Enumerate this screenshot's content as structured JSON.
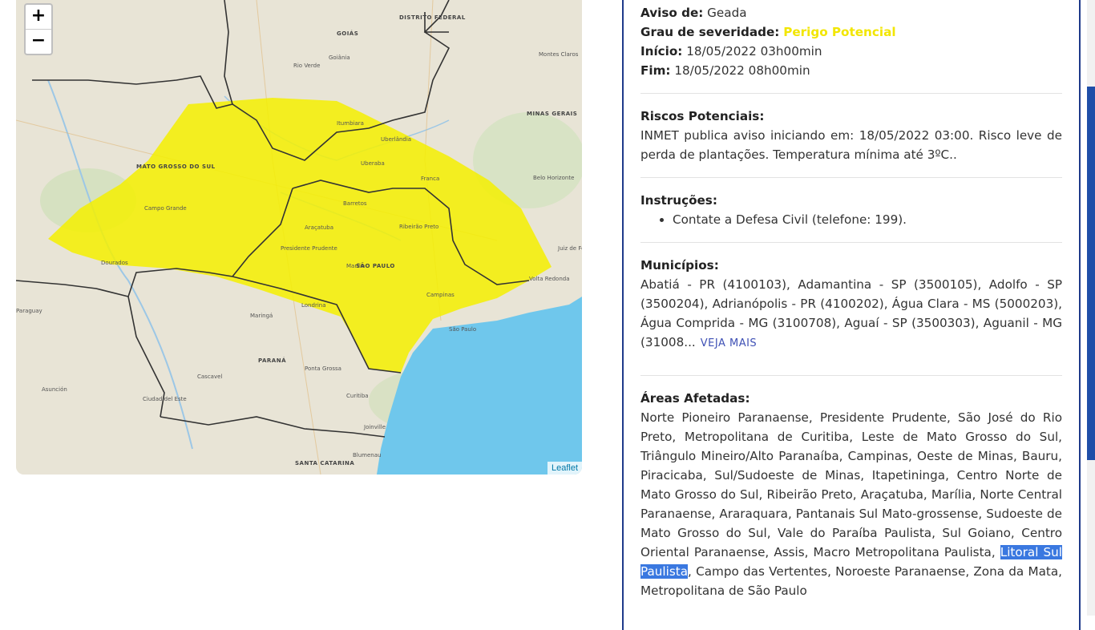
{
  "map": {
    "zoom_in": "+",
    "zoom_out": "−",
    "attribution": "Leaflet",
    "state_labels": [
      "GOIÁS",
      "MINAS GERAIS",
      "MATO GROSSO DO SUL",
      "SÃO PAULO",
      "PARANÁ",
      "SANTA CATARINA",
      "DISTRITO FEDERAL"
    ],
    "city_labels": [
      "São Paulo",
      "Campinas",
      "Curitiba",
      "Campo Grande",
      "Belo Horizonte",
      "Uberlândia",
      "Ribeirão Preto",
      "Paraguay",
      "Asunción",
      "Rio Verde",
      "Itumbiara",
      "Goiânia",
      "Montes Claros",
      "Juiz de Fora",
      "Volta Redonda",
      "Araçatuba",
      "Marília",
      "Presidente Prudente",
      "Cascavel",
      "Londrina",
      "Maringá",
      "Ponta Grossa",
      "Joinville",
      "Blumenau",
      "Dourados",
      "Ciudad del Este",
      "Franca",
      "Uberaba",
      "Barretos"
    ],
    "colors": {
      "warning_fill": "#f5f000",
      "ocean": "#6fc7ec",
      "land": "#e8e4d6",
      "border": "#333333"
    }
  },
  "alert": {
    "aviso_label": "Aviso de:",
    "aviso_value": "Geada",
    "grau_label": "Grau de severidade:",
    "grau_value": "Perigo Potencial",
    "grau_color": "#f2e600",
    "inicio_label": "Início:",
    "inicio_value": "18/05/2022 03h00min",
    "fim_label": "Fim:",
    "fim_value": "18/05/2022 08h00min",
    "riscos_title": "Riscos Potenciais:",
    "riscos_text": "INMET publica aviso iniciando em: 18/05/2022 03:00. Risco leve de perda de plantações. Temperatura mínima até 3ºC..",
    "instrucoes_title": "Instruções:",
    "instrucoes_items": [
      "Contate a Defesa Civil (telefone: 199)."
    ],
    "municipios_title": "Municípios:",
    "municipios_text": "Abatiá - PR (4100103), Adamantina - SP (3500105), Adolfo - SP (3500204), Adrianópolis - PR (4100202), Água Clara - MS (5000203), Água Comprida - MG (3100708), Aguaí - SP (3500303), Aguanil - MG (31008...",
    "veja_mais": "VEJA MAIS",
    "areas_title": "Áreas Afetadas:",
    "areas_before": "Norte Pioneiro Paranaense, Presidente Prudente, São José do Rio Preto, Metropolitana de Curitiba, Leste de Mato Grosso do Sul, Triângulo Mineiro/Alto Paranaíba, Campinas, Oeste de Minas, Bauru, Piracicaba, Sul/Sudoeste de Minas, Itapetininga, Centro Norte de Mato Grosso do Sul, Ribeirão Preto, Araçatuba, Marília, Norte Central Paranaense, Araraquara, Pantanais Sul Mato-grossense, Sudoeste de Mato Grosso do Sul, Vale do Paraíba Paulista, Sul Goiano, Centro Oriental Paranaense, Assis, Macro Metropolitana Paulista, ",
    "areas_selected": "Litoral Sul Paulista",
    "areas_after": ", Campo das Vertentes, Noroeste Paranaense, Zona da Mata, Metropolitana de São Paulo"
  }
}
